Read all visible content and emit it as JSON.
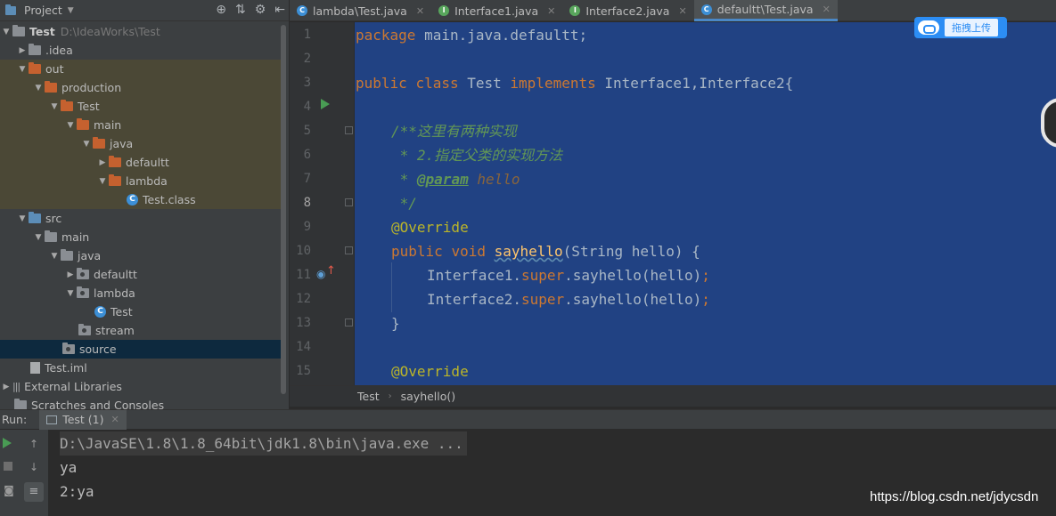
{
  "project_panel": {
    "title": "Project",
    "tree": [
      {
        "label": "Test",
        "path": "D:\\IdeaWorks\\Test"
      },
      {
        "label": ".idea"
      },
      {
        "label": "out"
      },
      {
        "label": "production"
      },
      {
        "label": "Test"
      },
      {
        "label": "main"
      },
      {
        "label": "java"
      },
      {
        "label": "defaultt"
      },
      {
        "label": "lambda"
      },
      {
        "label": "Test.class"
      },
      {
        "label": "src"
      },
      {
        "label": "main"
      },
      {
        "label": "java"
      },
      {
        "label": "defaultt"
      },
      {
        "label": "lambda"
      },
      {
        "label": "Test"
      },
      {
        "label": "stream"
      },
      {
        "label": "source"
      },
      {
        "label": "Test.iml"
      },
      {
        "label": "External Libraries"
      },
      {
        "label": "Scratches and Consoles"
      }
    ]
  },
  "editor_tabs": [
    {
      "label": "lambda\\Test.java",
      "icon": "C"
    },
    {
      "label": "Interface1.java",
      "icon": "I"
    },
    {
      "label": "Interface2.java",
      "icon": "I"
    },
    {
      "label": "defaultt\\Test.java",
      "icon": "C"
    }
  ],
  "editor": {
    "line_numbers": [
      "1",
      "2",
      "3",
      "4",
      "5",
      "6",
      "7",
      "8",
      "9",
      "10",
      "11",
      "12",
      "13",
      "14",
      "15"
    ],
    "code": {
      "l1_kw": "package",
      "l1_rest": " main.java.defaultt;",
      "l3_kw1": "public",
      "l3_kw2": "class",
      "l3_name": " Test ",
      "l3_kw3": "implements",
      "l3_rest": " Interface1,Interface2{",
      "l5": "/**这里有两种实现",
      "l6": " * 2.指定父类的实现方法",
      "l7_pre": " * ",
      "l7_tag": "@param",
      "l7_param": " hello",
      "l8": " */",
      "l9": "@Override",
      "l10_kw1": "public",
      "l10_kw2": "void",
      "l10_fn": "sayhello",
      "l10_rest": "(String hello) {",
      "l11_a": "Interface1.",
      "l11_kw": "super",
      "l11_b": ".sayhello(hello)",
      "l11_semi": ";",
      "l12_a": "Interface2.",
      "l12_kw": "super",
      "l12_b": ".sayhello(hello)",
      "l12_semi": ";",
      "l13": "}",
      "l15": "@Override"
    }
  },
  "upload_badge": {
    "label": "拖拽上传"
  },
  "breadcrumb": {
    "items": [
      "Test",
      "sayhello()"
    ]
  },
  "run_panel": {
    "label": "Run:",
    "tab_label": "Test (1)",
    "output": [
      "D:\\JavaSE\\1.8\\1.8_64bit\\jdk1.8\\bin\\java.exe ...",
      "ya",
      "2:ya"
    ]
  },
  "watermark": "https://blog.csdn.net/jdycsdn",
  "colors": {
    "selection": "#214283",
    "keyword": "#cc7832",
    "comment": "#629755",
    "annotation": "#bbb529",
    "function": "#ffc66d",
    "panel": "#3c3f41",
    "editor_bg": "#2b2b2b"
  }
}
